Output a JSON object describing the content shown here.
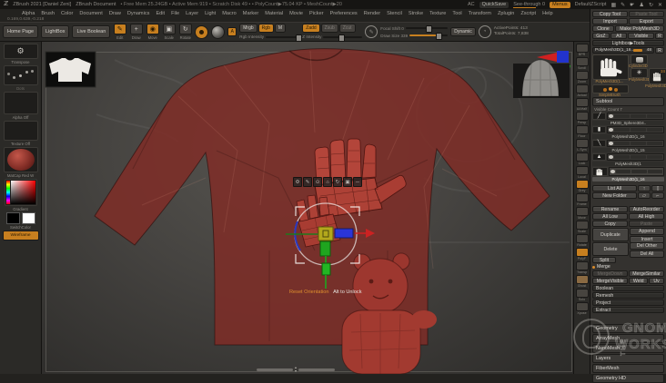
{
  "title_bar": {
    "app_title": "ZBrush 2021 [Daniel Zeni]",
    "document_title": "ZBrush Document",
    "stats": "• Free Mem 25.24GB • Active Mem 919 • Scratch Disk 49 • • PolyCount▶75.04 KP • MeshCount▶20",
    "ac_label": "AC",
    "quicksave_label": "QuickSave",
    "see_through_label": "See-through 0",
    "menus_label": "Menus",
    "zscript_label": "DefaultZScript",
    "close_glyph": "✕"
  },
  "menu_bar": {
    "items": [
      "Alpha",
      "Brush",
      "Color",
      "Document",
      "Draw",
      "Dynamics",
      "Edit",
      "File",
      "Layer",
      "Light",
      "Macro",
      "Marker",
      "Material",
      "Movie",
      "Picker",
      "Preferences",
      "Render",
      "Stencil",
      "Stroke",
      "Texture",
      "Tool",
      "Transform",
      "Zplugin",
      "Zscript",
      "Help"
    ]
  },
  "status_coords": "0.169,0.639,-0.218",
  "toolbar": {
    "home_page_label": "Home Page",
    "lightbox_label": "LightBox",
    "live_boolean_label": "Live Boolean",
    "mode_labels": [
      "Edit",
      "Draw",
      "Move",
      "Scale",
      "Rotate"
    ],
    "a_label": "A",
    "paint_buttons": [
      "Mrgb",
      "Rgb",
      "M"
    ],
    "rgb_intensity_label": "Rgb Intensity",
    "sculpt_buttons": [
      "Zadd",
      "Zsub",
      "Zcut"
    ],
    "z_intensity_label": "Z Intensity",
    "focal_shift_label": "Focal Shift 0",
    "draw_size_label": "Draw Size 339",
    "dynamic_label": "Dynamic",
    "active_points": "ActivePoints: 413",
    "total_points": "TotalPoints: 7,838"
  },
  "left_shelf": {
    "brush_label": "Transpose",
    "stroke_label": "Dots",
    "alpha_label": "Alpha Off",
    "texture_label": "Texture Off",
    "material_label": "MatCap Red W",
    "gradient_label": "Gradient",
    "switch_color_label": "SwitchColor",
    "wireframe_label": "Wireframe"
  },
  "canvas": {
    "reset_orientation": "Reset Orientation",
    "alt_to_unlock": "Alt to Unlock"
  },
  "right_shelf": {
    "icons": [
      {
        "label": "BPR"
      },
      {
        "label": "Scroll"
      },
      {
        "label": "Zoom"
      },
      {
        "label": "Actual"
      },
      {
        "label": "AAHalf"
      },
      {
        "label": "Persp"
      },
      {
        "label": "Floor"
      },
      {
        "label": "L.Sym"
      },
      {
        "label": "Lock"
      },
      {
        "label": "Local"
      },
      {
        "label": "Grey"
      },
      {
        "label": "Frame"
      },
      {
        "label": "Move"
      },
      {
        "label": "Scale"
      },
      {
        "label": "Rotate"
      },
      {
        "label": "PolyF"
      },
      {
        "label": "Transp"
      },
      {
        "label": "Ghost"
      },
      {
        "label": "Solo"
      },
      {
        "label": "Xpose"
      }
    ]
  },
  "tool_panel": {
    "copy_tool": "Copy Tool",
    "paste_tool": "Paste Tool",
    "import": "Import",
    "export": "Export",
    "clone": "Clone",
    "make_polymesh": "Make PolyMesh3D",
    "goz": "GoZ",
    "all": "All",
    "visible": "Visible",
    "r": "R",
    "lightbox_tools": "Lightbox▶Tools",
    "tool_name_slider": "PolyMesh3D(1_16..",
    "tool_name_value": "48",
    "r2": "R",
    "active_tool_label": "PolyMesh3D(1...",
    "tool_thumbs": [
      "Cylinder3D",
      "PolyMesh3D",
      "SimpleBrush",
      "PolyMesh3D(1..."
    ],
    "tool_badge": "24",
    "subtool": {
      "header": "Subtool",
      "visible_count": "Visible Count 7",
      "items": [
        "PM3D_Sphere3D4..",
        "PolyMesh3D(1_16",
        "PolyMesh3D(1_15",
        "PolyMesh3D(1",
        "PolyMesh3D(1_16"
      ]
    },
    "list_all": "List All",
    "new_folder": "New Folder",
    "rename": "Rename",
    "auto_reorder": "AutoReorder",
    "all_low": "All Low",
    "all_high": "All High",
    "copy": "Copy",
    "paste": "Paste",
    "duplicate": "Duplicate",
    "append": "Append",
    "insert": "Insert",
    "delete": "Delete",
    "del_other": "Del Other",
    "del_all": "Del All",
    "split": "Split",
    "merge_header": "Merge",
    "merge_down": "MergeDown",
    "merge_similar": "MergeSimilar",
    "merge_visible": "MergeVisible",
    "weld": "Weld",
    "uv": "Uv",
    "boolean": "Boolean",
    "remesh": "Remesh",
    "project": "Project",
    "extract": "Extract",
    "sections": [
      "Geometry",
      "ArrayMesh",
      "NanoMesh",
      "Layers",
      "FiberMesh",
      "Geometry HD"
    ]
  },
  "watermark": {
    "the": "THE",
    "gnomon": "GNOMON",
    "workshop": "WORKSHOP"
  }
}
